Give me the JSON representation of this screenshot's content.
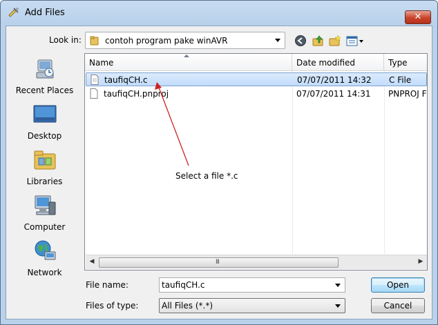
{
  "window": {
    "title": "Add Files",
    "close_glyph": "✕"
  },
  "lookin": {
    "label": "Look in:",
    "value": "contoh program pake winAVR"
  },
  "toolbar": {
    "icons": [
      "back-icon",
      "up-folder-icon",
      "new-folder-icon",
      "view-menu-icon"
    ]
  },
  "places": [
    {
      "label": "Recent Places",
      "icon": "recent-places-icon"
    },
    {
      "label": "Desktop",
      "icon": "desktop-icon"
    },
    {
      "label": "Libraries",
      "icon": "libraries-icon"
    },
    {
      "label": "Computer",
      "icon": "computer-icon"
    },
    {
      "label": "Network",
      "icon": "network-icon"
    }
  ],
  "columns": [
    "Name",
    "Date modified",
    "Type"
  ],
  "files": [
    {
      "name": "taufiqCH.c",
      "date": "07/07/2011 14:32",
      "type": "C File",
      "selected": true
    },
    {
      "name": "taufiqCH.pnproj",
      "date": "07/07/2011 14:31",
      "type": "PNPROJ F",
      "selected": false
    }
  ],
  "annotation": {
    "text": "Select a file *.c",
    "color": "#cc2222"
  },
  "scrollbar": {
    "left_glyph": "◀",
    "right_glyph": "▶",
    "grip": "III"
  },
  "filename": {
    "label": "File name:",
    "value": "taufiqCH.c"
  },
  "filetype": {
    "label": "Files of type:",
    "value": "All Files (*.*)"
  },
  "buttons": {
    "open": "Open",
    "cancel": "Cancel"
  }
}
